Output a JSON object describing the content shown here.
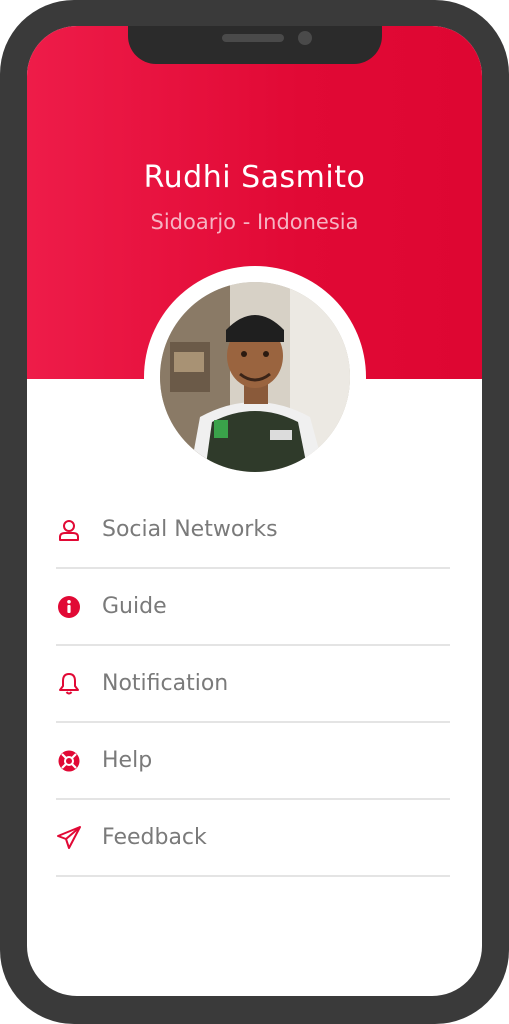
{
  "profile": {
    "name": "Rudhi Sasmito",
    "location": "Sidoarjo - Indonesia"
  },
  "menu": {
    "items": [
      {
        "label": "Social Networks",
        "icon": "user-icon"
      },
      {
        "label": "Guide",
        "icon": "info-icon"
      },
      {
        "label": "Notification",
        "icon": "bell-icon"
      },
      {
        "label": "Help",
        "icon": "lifebuoy-icon"
      },
      {
        "label": "Feedback",
        "icon": "paper-plane-icon"
      }
    ]
  },
  "colors": {
    "accent": "#e10935",
    "header_start": "#ee1c49",
    "header_end": "#de0632",
    "frame": "#3a3a3a",
    "label": "#7a7a7a",
    "divider": "#e4e4e4"
  }
}
